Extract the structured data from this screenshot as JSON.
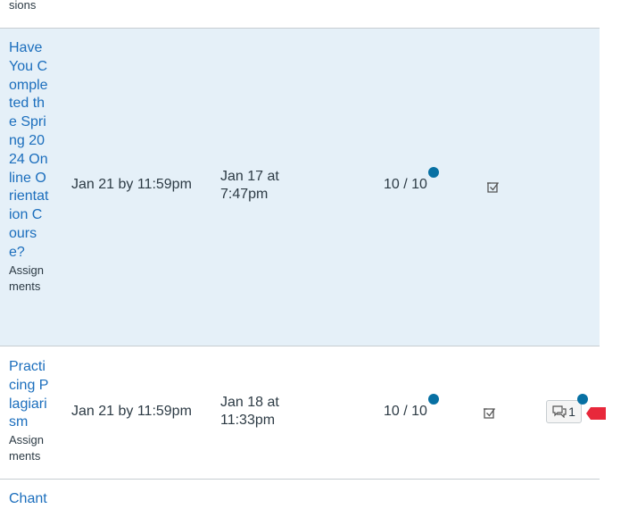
{
  "rows": [
    {
      "type_fragment": "sions"
    },
    {
      "title": "Have You Completed the Spring 2024 Online Orientation Course?",
      "type_label": "Assignments",
      "due": "Jan 21 by 11:59pm",
      "submitted": "Jan 17 at 7:47pm",
      "score": "10 / 10",
      "status_icon": "checkmark-submitted-icon",
      "unread_indicator": true
    },
    {
      "title": "Practicing Plagiarism",
      "type_label": "Assignments",
      "due": "Jan 21 by 11:59pm",
      "submitted": "Jan 18 at 11:33pm",
      "score": "10 / 10",
      "status_icon": "checkmark-submitted-icon",
      "unread_indicator": true,
      "comments": {
        "count": "1",
        "icon": "comment-bubble-icon",
        "unread_indicator": true
      }
    },
    {
      "title_fragment": "Chant"
    }
  ],
  "colors": {
    "link": "#1b6ebd",
    "highlight_row": "#e5f0f8",
    "unread_dot": "#0770a3",
    "annotation_marker": "#e8283b"
  }
}
